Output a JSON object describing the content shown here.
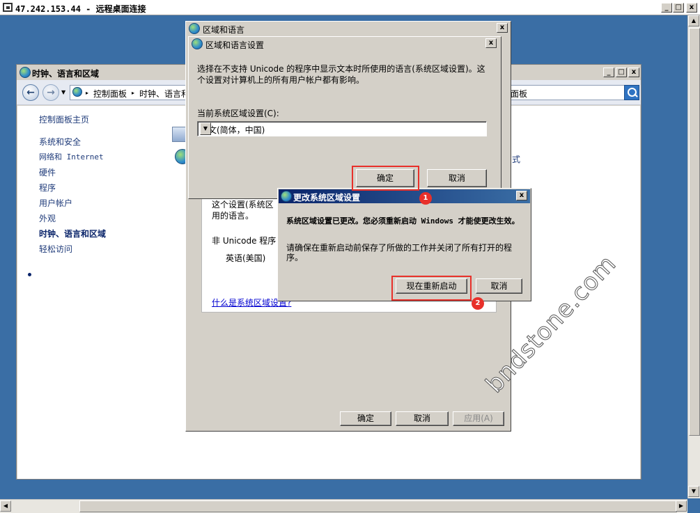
{
  "rdp": {
    "title": "47.242.153.44 - 远程桌面连接",
    "btn_min": "_",
    "btn_max": "□",
    "btn_close": "x"
  },
  "control_panel": {
    "title": "时钟、语言和区域",
    "breadcrumb_root": "控制面板",
    "breadcrumb_current": "时钟、语言和",
    "search_fragment": "面板",
    "sidebar": [
      {
        "label": "控制面板主页"
      },
      {
        "label": "系统和安全"
      },
      {
        "label": "网络和 Internet"
      },
      {
        "label": "硬件"
      },
      {
        "label": "程序"
      },
      {
        "label": "用户帐户"
      },
      {
        "label": "外观"
      },
      {
        "label": "时钟、语言和区域"
      },
      {
        "label": "轻松访问"
      }
    ],
    "right_fragment": "式"
  },
  "region_dialog": {
    "title": "区域和语言",
    "panel_line1": "这个设置(系统区",
    "panel_line2": "用的语言。",
    "non_unicode_label": "非 Unicode 程序",
    "current_lang": "英语(美国)",
    "link": "什么是系统区域设置?",
    "ok": "确定",
    "cancel": "取消",
    "apply": "应用(A)"
  },
  "settings_dialog": {
    "title": "区域和语言设置",
    "description": "选择在不支持 Unicode 的程序中显示文本时所使用的语言(系统区域设置)。这个设置对计算机上的所有用户帐户都有影响。",
    "label": "当前系统区域设置(C):",
    "selected": "中文(简体，中国)",
    "ok": "确定",
    "cancel": "取消"
  },
  "restart_dialog": {
    "title": "更改系统区域设置",
    "main": "系统区域设置已更改。您必须重新启动 Windows 才能使更改生效。",
    "sub": "请确保在重新启动前保存了所做的工作并关闭了所有打开的程序。",
    "restart_now": "现在重新启动",
    "cancel": "取消"
  },
  "annotations": {
    "marker1": "1",
    "marker2": "2",
    "color": "#e8302a"
  },
  "watermark": "bndstone.com"
}
